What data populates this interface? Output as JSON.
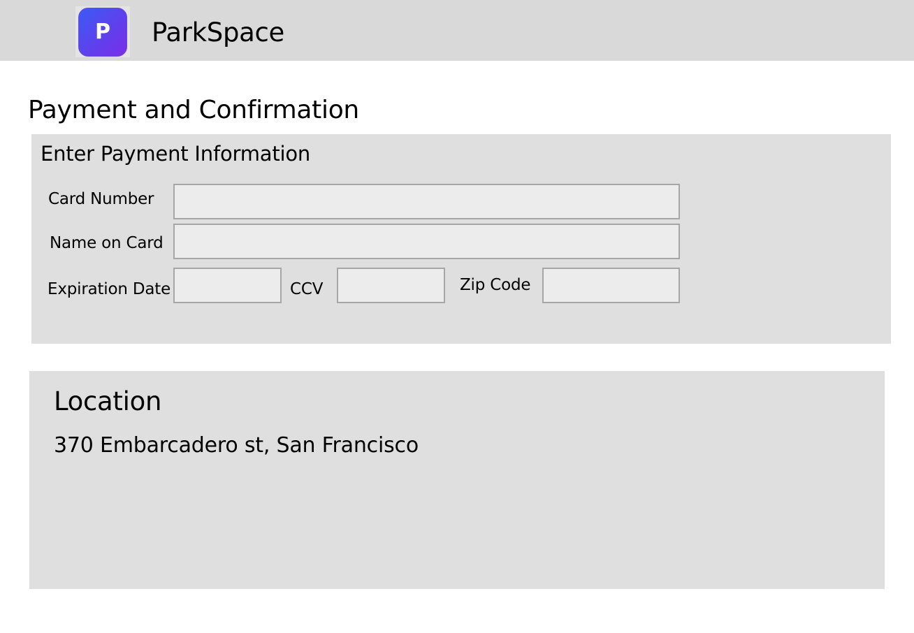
{
  "header": {
    "logo_letter": "P",
    "app_name": "ParkSpace"
  },
  "page": {
    "title": "Payment and Confirmation"
  },
  "payment": {
    "heading": "Enter Payment Information",
    "card_number": {
      "label": "Card Number",
      "value": ""
    },
    "name_on_card": {
      "label": "Name on Card",
      "value": ""
    },
    "expiration_date": {
      "label": "Expiration Date",
      "value": ""
    },
    "ccv": {
      "label": "CCV",
      "value": ""
    },
    "zip_code": {
      "label": "Zip Code",
      "value": ""
    }
  },
  "location": {
    "heading": "Location",
    "address": "370 Embarcadero st, San Francisco"
  },
  "colors": {
    "header_bg": "#d9d9d9",
    "panel_bg": "#dfdfdf",
    "input_bg": "#ececec",
    "input_border": "#a6a6a6",
    "logo_gradient_start": "#3b5bf6",
    "logo_gradient_end": "#7a2de8"
  },
  "icons": {
    "app_logo": "parkspace-logo-icon"
  }
}
